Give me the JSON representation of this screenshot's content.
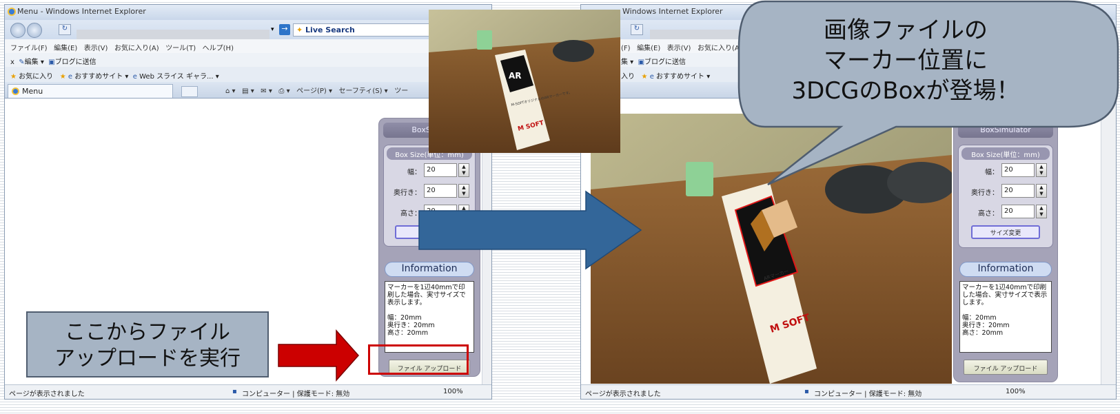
{
  "left_window": {
    "title": "Menu - Windows Internet Explorer",
    "search_label": "Live Search",
    "menu": [
      "ファイル(F)",
      "編集(E)",
      "表示(V)",
      "お気に入り(A)",
      "ツール(T)",
      "ヘルプ(H)"
    ],
    "bar2": {
      "close": "x",
      "edit": "編集",
      "blog": "ブログに送信"
    },
    "bar3": {
      "favorites": "お気に入り",
      "suggested": "おすすめサイト",
      "web_slice": "Web スライス ギャラ..."
    },
    "tab": "Menu",
    "tools": [
      "ページ(P)",
      "セーフティ(S)",
      "ツー"
    ],
    "status": {
      "left": "ページが表示されました",
      "zone": "コンピューター | 保護モード: 無効",
      "zoom": "100%"
    }
  },
  "right_window": {
    "title": "Windows Internet Explorer",
    "menu": [
      "(F)",
      "編集(E)",
      "表示(V)",
      "お気に入り(A)"
    ],
    "bar2": {
      "edit": "集",
      "blog": "ブログに送信"
    },
    "bar3": {
      "favorites": "入り",
      "suggested": "おすすめサイト"
    },
    "status": {
      "left": "ページが表示されました",
      "zone": "コンピューター | 保護モード: 無効",
      "zoom": "100%"
    }
  },
  "panel": {
    "title": "BoxSimulator",
    "box_size_header": "Box Size(単位：mm)",
    "fields": [
      {
        "label": "幅：",
        "value": "20"
      },
      {
        "label": "奥行き：",
        "value": "20"
      },
      {
        "label": "高さ：",
        "value": "20"
      }
    ],
    "size_button": "サイズ変更",
    "info_header": "Information",
    "info_text": "マーカーを1辺40mmで印刷した場合、実寸サイズで表示します。\n\n幅：20mm\n奥行き：20mm\n高さ：20mm",
    "upload_button": "ファイル アップロード"
  },
  "left_panel_partial": {
    "title": "BoxSimul",
    "box_size_header": "Box Size(単位：mm)",
    "size_button": "サイ"
  },
  "callouts": {
    "upload_note": [
      "ここからファイル",
      "アップロードを実行"
    ],
    "speech": [
      "画像ファイルの",
      "マーカー位置に",
      "3DCGのBoxが登場！"
    ]
  },
  "marker": {
    "ar": "AR",
    "name": "ARマーカー",
    "desc": "M-SOFTオリジナルのARマーカーです。",
    "brand": "M SOFT"
  },
  "colors": {
    "blue_arrow": "#336699",
    "red_arrow": "#cc0000",
    "callout": "#a6b4c4",
    "panel": "#a5a3b8"
  }
}
